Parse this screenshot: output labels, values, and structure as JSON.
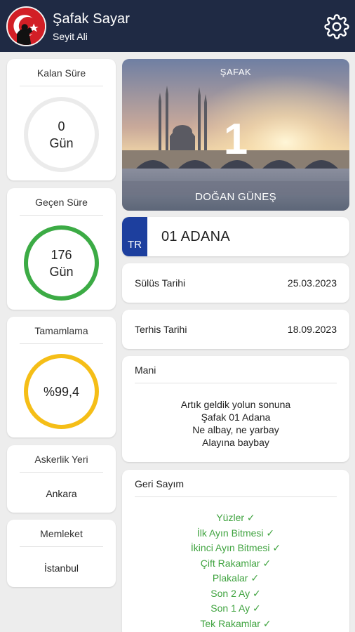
{
  "header": {
    "title": "Şafak Sayar",
    "subtitle": "Seyit Ali",
    "avatar_color": "#d21f26",
    "bar_color": "#1f2a44"
  },
  "left": {
    "kalan": {
      "title": "Kalan Süre",
      "value": "0",
      "unit": "Gün",
      "ring_color": "#ebebeb"
    },
    "gecen": {
      "title": "Geçen Süre",
      "value": "176",
      "unit": "Gün",
      "ring_color": "#3cab45"
    },
    "tamamlama": {
      "title": "Tamamlama",
      "value": "%99,4",
      "ring_color": "#f5be17"
    },
    "askerlik": {
      "title": "Askerlik Yeri",
      "value": "Ankara"
    },
    "memleket": {
      "title": "Memleket",
      "value": "İstanbul"
    }
  },
  "hero": {
    "top_label": "ŞAFAK",
    "number": "1",
    "bottom_label": "DOĞAN GÜNEŞ"
  },
  "plate": {
    "country": "TR",
    "text": "01 ADANA",
    "band_color": "#1d3f9e"
  },
  "sulus": {
    "label": "Sülüs Tarihi",
    "value": "25.03.2023"
  },
  "terhis": {
    "label": "Terhis Tarihi",
    "value": "18.09.2023"
  },
  "mani": {
    "title": "Mani",
    "lines": [
      "Artık geldik yolun sonuna",
      "Şafak 01 Adana",
      "Ne albay, ne yarbay",
      "Alayına baybay"
    ]
  },
  "geri_sayim": {
    "title": "Geri Sayım",
    "check_color": "#3fa33f",
    "items": [
      "Yüzler",
      "İlk Ayın Bitmesi",
      "İkinci Ayın Bitmesi",
      "Çift Rakamlar",
      "Plakalar",
      "Son 2 Ay",
      "Son 1 Ay",
      "Tek Rakamlar"
    ],
    "check_glyph": "✓"
  }
}
